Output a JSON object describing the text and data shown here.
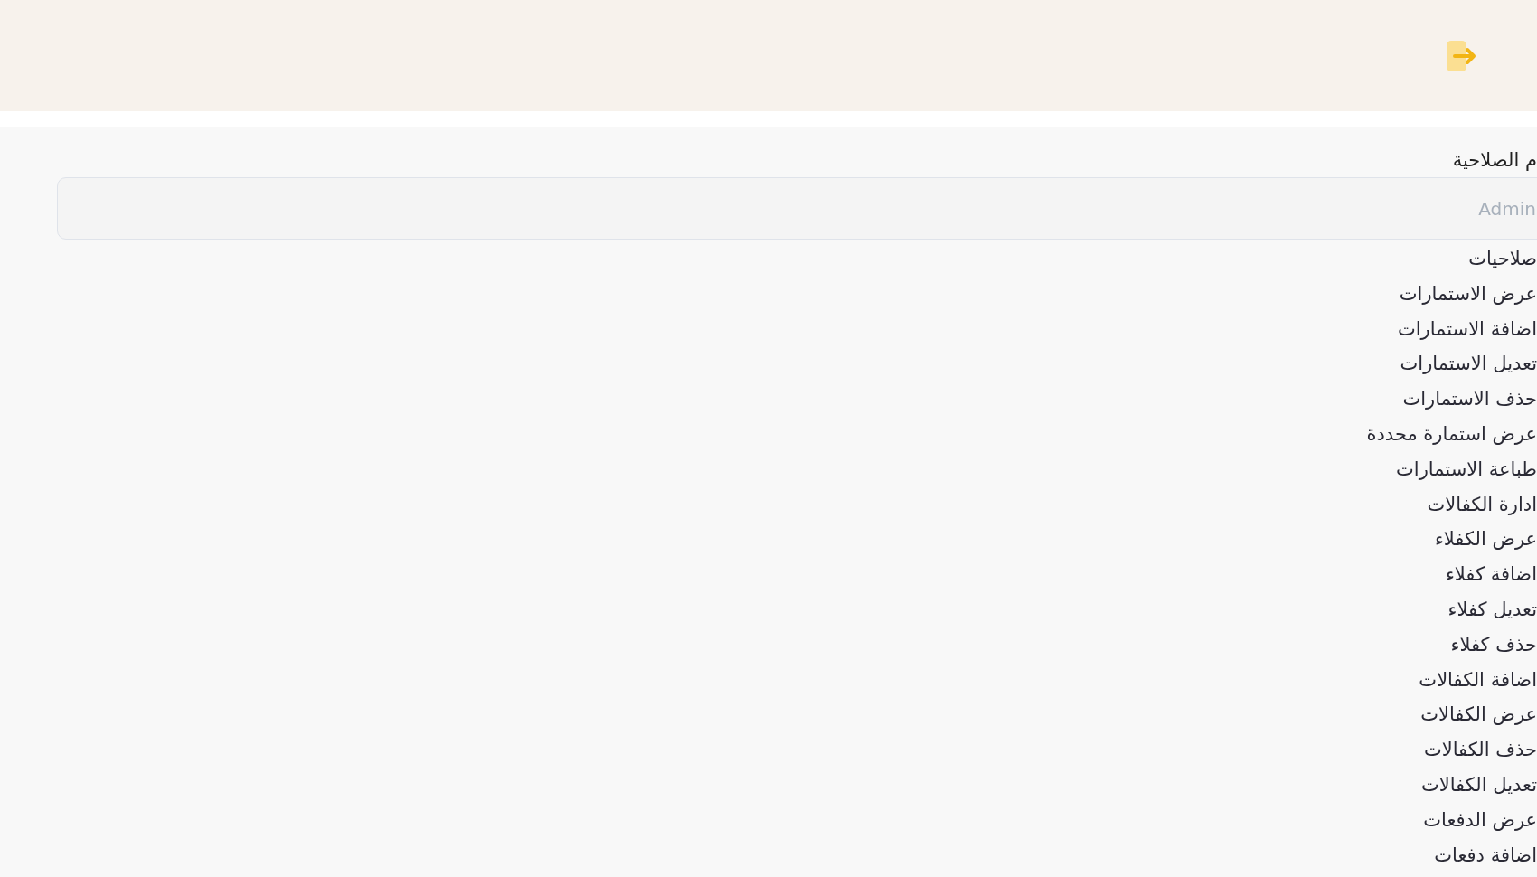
{
  "form": {
    "label": "م الصلاحية",
    "placeholder": "Admin"
  },
  "permissions": [
    "صلاحيات",
    "عرض الاستمارات",
    "اضافة الاستمارات",
    "تعديل الاستمارات",
    "حذف الاستمارات",
    "عرض استمارة محددة",
    "طباعة الاستمارات",
    "ادارة الكفالات",
    "عرض الكفلاء",
    "اضافة كفلاء",
    "تعديل كفلاء",
    "حذف كفلاء",
    "اضافة الكفالات",
    "عرض الكفالات",
    "حذف الكفالات",
    "تعديل الكفالات",
    "عرض الدفعات",
    "اضافة دفعات"
  ]
}
